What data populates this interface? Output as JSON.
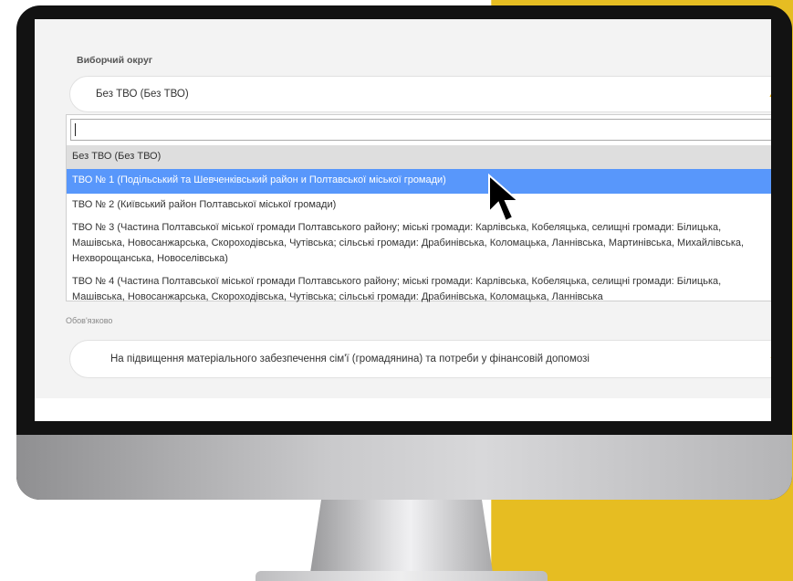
{
  "form": {
    "district_label": "Виборчий округ",
    "district_selected": "Без ТВО (Без ТВО)",
    "search_value": "",
    "options": [
      "Без ТВО (Без ТВО)",
      "ТВО № 1 (Подільський та Шевченківський район и Полтавської міської громади)",
      "ТВО № 2 (Київський район Полтавської міської громади)",
      "ТВО № 3 (Частина Полтавської міської громади Полтавського району; міські громади: Карлівська, Кобеляцька, селищні громади: Білицька, Машівська, Новосанжарська, Скороходівська, Чутівська; сільські громади: Драбинівська, Коломацька, Ланнівська, Мартинівська, Михайлівська, Нехворощанська, Новоселівська)",
      "ТВО № 4 (Частина Полтавської міської громади Полтавського району; міські громади: Карлівська, Кобеляцька, селищні громади: Білицька, Машівська, Новосанжарська, Скороходівська, Чутівська; сільські громади: Драбинівська, Коломацька, Ланнівська"
    ],
    "required_note": "Обов'язково",
    "purpose_selected": "На підвищення матеріального забезпечення сім'ї (громадянина) та потреби у фінансовій допомозі"
  },
  "colors": {
    "accent_yellow": "#e6bd22",
    "highlight_blue": "#5897fb",
    "monitor_bezel": "#121212"
  },
  "icons": {
    "caret_up": "▲",
    "caret_down": "▼",
    "cursor": "mouse-pointer-arrow"
  }
}
